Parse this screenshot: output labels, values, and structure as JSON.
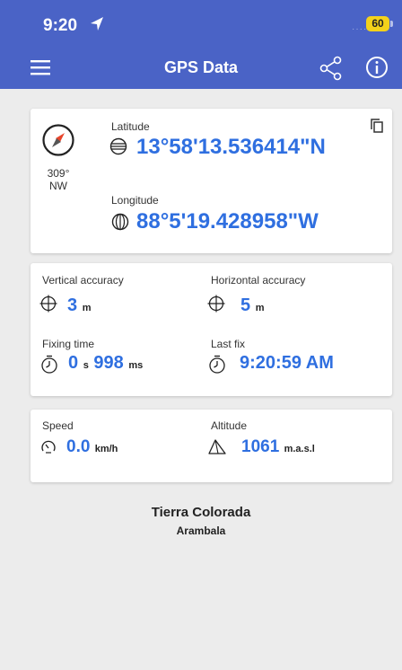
{
  "status": {
    "time": "9:20",
    "battery": "60"
  },
  "appbar": {
    "title": "GPS Data"
  },
  "position": {
    "heading_deg": "309°",
    "heading_dir": "NW",
    "latitude_label": "Latitude",
    "latitude_value": "13°58'13.536414\"N",
    "longitude_label": "Longitude",
    "longitude_value": "88°5'19.428958\"W"
  },
  "accuracy": {
    "vertical_label": "Vertical accuracy",
    "vertical_value": "3",
    "vertical_unit": "m",
    "horizontal_label": "Horizontal accuracy",
    "horizontal_value": "5",
    "horizontal_unit": "m",
    "fixing_label": "Fixing time",
    "fixing_seconds": "0",
    "fixing_s_unit": "s",
    "fixing_ms": "998",
    "fixing_ms_unit": "ms",
    "lastfix_label": "Last fix",
    "lastfix_value": "9:20:59 AM"
  },
  "motion": {
    "speed_label": "Speed",
    "speed_value": "0.0",
    "speed_unit": "km/h",
    "altitude_label": "Altitude",
    "altitude_value": "1061",
    "altitude_unit": "m.a.s.l"
  },
  "place": {
    "name": "Tierra Colorada",
    "region": "Arambala"
  },
  "colors": {
    "appbar": "#4a63c6",
    "accent": "#2f6fe0",
    "compass_needle": "#e8452c",
    "battery": "#f4d21a"
  }
}
